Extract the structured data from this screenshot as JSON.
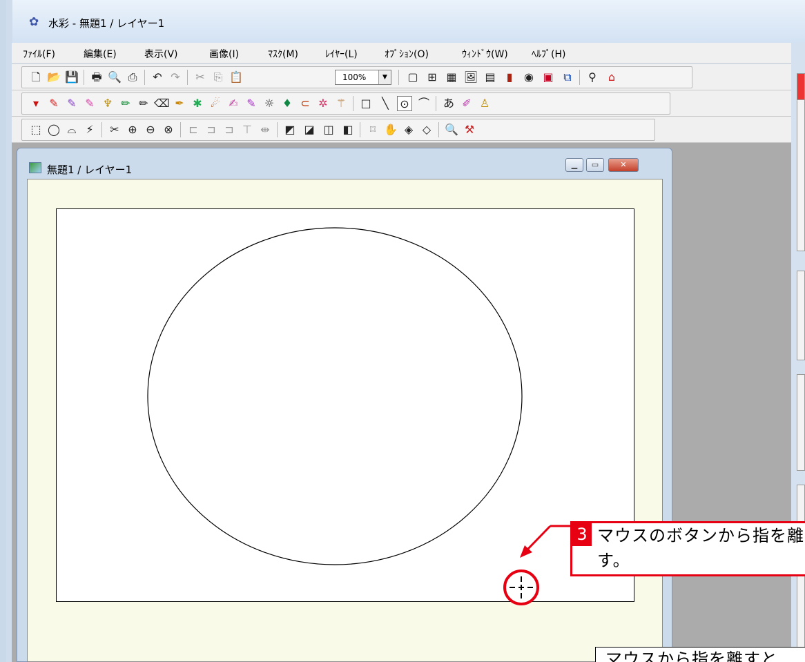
{
  "app": {
    "title": "水彩 - 無題1 / レイヤー1",
    "icon": "paint-app-icon"
  },
  "menu": [
    "ﾌｧｲﾙ(F)",
    "編集(E)",
    "表示(V)",
    "画像(I)",
    "ﾏｽｸ(M)",
    "ﾚｲﾔｰ(L)",
    "ｵﾌﾟｼｮﾝ(O)",
    "ｳｨﾝﾄﾞｳ(W)",
    "ﾍﾙﾌﾟ(H)"
  ],
  "toolbar": {
    "zoom_value": "100%"
  },
  "document": {
    "title": "無題1 / レイヤー1"
  },
  "callout": {
    "number": "3",
    "text": "マウスのボタンから指を離\nす。"
  },
  "note": {
    "text": "マウスから指を離すと"
  },
  "colors": {
    "accent_red": "#e60012",
    "canvas_bg": "#fafae8"
  }
}
